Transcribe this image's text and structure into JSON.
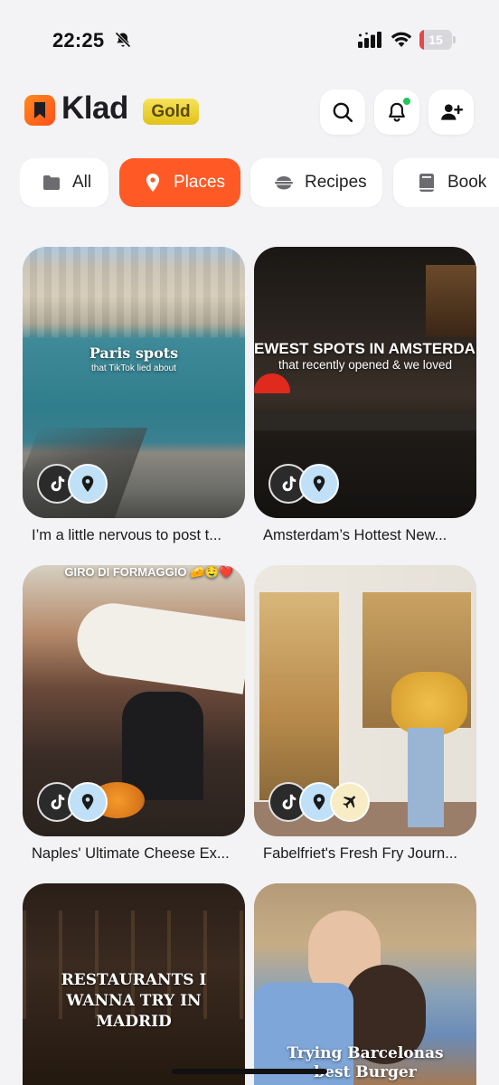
{
  "status_bar": {
    "time": "22:25",
    "battery_level": "15",
    "battery_percent": 15,
    "icons": [
      "bell-slash-icon",
      "cellular-signal-icon",
      "wifi-icon",
      "battery-icon"
    ]
  },
  "header": {
    "app_name": "Klad",
    "badge": "Gold",
    "actions": [
      "search-icon",
      "bell-icon",
      "add-user-icon"
    ],
    "notification_dot_color": "#22c55e"
  },
  "filters": {
    "active": "Places",
    "items": [
      {
        "label": "All",
        "icon": "folder-icon"
      },
      {
        "label": "Places",
        "icon": "map-pin-icon"
      },
      {
        "label": "Recipes",
        "icon": "bowl-icon"
      },
      {
        "label": "Book",
        "icon": "book-icon"
      }
    ]
  },
  "colors": {
    "accent": "#ff5a26",
    "background": "#f3f3f5",
    "gold": "#e8cf2a"
  },
  "cards": [
    {
      "title": "I’m a little nervous to post t...",
      "overlay_title": "Paris spots",
      "overlay_subtitle": "that TikTok lied about",
      "badges": [
        "tiktok-icon",
        "map-pin-icon"
      ]
    },
    {
      "title": "Amsterdam’s Hottest New...",
      "overlay_title": "EWEST SPOTS IN AMSTERDAM",
      "overlay_subtitle": "that recently opened & we loved",
      "badges": [
        "tiktok-icon",
        "map-pin-icon"
      ]
    },
    {
      "title": "Naples' Ultimate Cheese Ex...",
      "overlay_title": "GIRO DI FORMAGGIO 🧀🤤❤️",
      "overlay_subtitle": "",
      "badges": [
        "tiktok-icon",
        "map-pin-icon"
      ]
    },
    {
      "title": "Fabelfriet's Fresh Fry Journ...",
      "overlay_title": "",
      "overlay_subtitle": "",
      "badges": [
        "tiktok-icon",
        "map-pin-icon",
        "airplane-icon"
      ]
    },
    {
      "title": "",
      "overlay_title": "RESTAURANTS I WANNA TRY IN MADRID",
      "overlay_subtitle": "",
      "badges": []
    },
    {
      "title": "",
      "overlay_title": "Trying Barcelonas best Burger",
      "overlay_subtitle": "",
      "badges": []
    }
  ]
}
